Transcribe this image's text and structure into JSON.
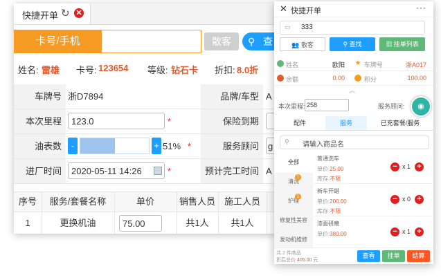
{
  "tab": {
    "title": "快捷开单",
    "refresh_icon": "↻",
    "close_icon": "✕"
  },
  "search": {
    "card_label": "卡号/手机",
    "scan_label": "散客",
    "find_label": "查",
    "search_icon": "⚲"
  },
  "member": {
    "name_label": "姓名:",
    "name": "雷雄",
    "card_label": "卡号:",
    "card": "123654",
    "level_label": "等级:",
    "level": "钻石卡",
    "discount_label": "折扣:",
    "discount": "8.0折"
  },
  "form": {
    "plate_label": "车牌号",
    "plate": "浙D7894",
    "brand_label": "品牌/车型",
    "brand": "A",
    "mileage_label": "本次里程",
    "mileage": "123.0",
    "insurance_label": "保险到期",
    "fuel_label": "油表数",
    "fuel_minus": "-",
    "fuel_plus": "+",
    "fuel_percent": "51%",
    "fuel_level": 0.51,
    "advisor_label": "服务顾问",
    "advisor": "g",
    "enter_label": "进厂时间",
    "enter_time": "2020-05-11 14:26",
    "finish_label": "预计完工时间",
    "finish": "A",
    "required_mark": "*"
  },
  "table": {
    "headers": [
      "序号",
      "服务/套餐名称",
      "单价",
      "销售人员",
      "施工人员"
    ],
    "rows": [
      {
        "no": "1",
        "name": "更换机油",
        "price": "75.00",
        "sales": "共1人",
        "worker": "共1人"
      }
    ]
  },
  "panel": {
    "close_icon": "✕",
    "title": "快捷开单",
    "menu_icon": "···",
    "search_value": "333",
    "search_icon": "▭",
    "buttons": {
      "guest": "散客",
      "find": "查找",
      "list": "挂单列表"
    },
    "info": {
      "name_label": "姓名",
      "name": "欧阳",
      "plate_label": "车牌号",
      "plate": "浙A017",
      "balance_label": "余额",
      "balance": "0.00",
      "points_label": "积分",
      "points": "100.00"
    },
    "expand_icon": "︿",
    "mileage_label": "本次里程:",
    "mileage": "258",
    "advisor_label": "服务顾问:",
    "tabs": [
      "配件",
      "服务",
      "已充套餐/服务"
    ],
    "goods_placeholder": "请输入商品名",
    "categories": [
      {
        "label": "全部",
        "badge": ""
      },
      {
        "label": "清洗",
        "badge": "1"
      },
      {
        "label": "护理",
        "badge": "1"
      },
      {
        "label": "修复性美容",
        "badge": ""
      },
      {
        "label": "发动机维修",
        "badge": ""
      }
    ],
    "items": [
      {
        "name": "普通洗车",
        "price_label": "单价:",
        "price": "25.00",
        "stock_label": "库存:",
        "stock": "不限",
        "qty": "x 1"
      },
      {
        "name": "新车开蜡",
        "price_label": "单价:",
        "price": "200.00",
        "stock_label": "库存:",
        "stock": "不限",
        "qty": "x 0"
      },
      {
        "name": "漆面研磨",
        "price_label": "单价:",
        "price": "380.00",
        "stock_label": "",
        "stock": "",
        "qty": "x 1"
      }
    ],
    "footer": {
      "count_text": "共 2 件商品",
      "total_label": "折后总价",
      "total": "405.00",
      "unit": "元",
      "view": "查看",
      "hang": "挂单",
      "checkout": "结算"
    }
  },
  "colors": {
    "accent": "#f59a23",
    "blue": "#1e9fff",
    "green": "#5fb878",
    "red": "#e02020"
  }
}
